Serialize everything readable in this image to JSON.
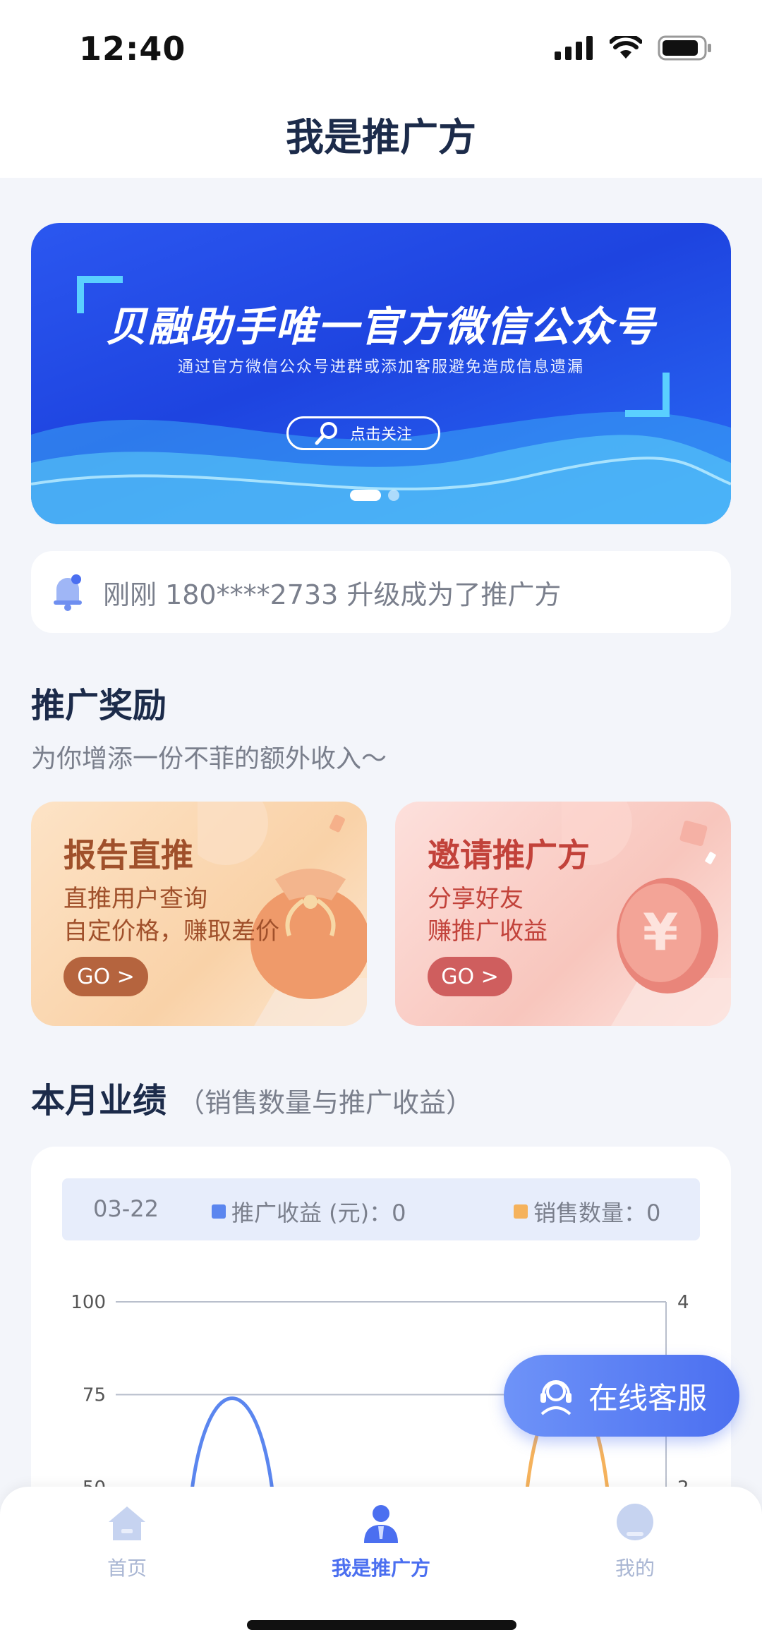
{
  "status_bar": {
    "time": "12:40"
  },
  "nav": {
    "title": "我是推广方"
  },
  "banner": {
    "title": "贝融助手唯一官方微信公众号",
    "subtitle": "通过官方微信公众号进群或添加客服避免造成信息遗漏",
    "button_label": "点击关注",
    "page_count": 2,
    "active_page": 1
  },
  "notice": {
    "text": "刚刚 180****2733 升级成为了推广方"
  },
  "rewards": {
    "title": "推广奖励",
    "subtitle": "为你增添一份不菲的额外收入～",
    "cards": [
      {
        "title": "报告直推",
        "line1": "直推用户查询",
        "line2": "自定价格，赚取差价",
        "go": "GO >"
      },
      {
        "title": "邀请推广方",
        "line1": "分享好友",
        "line2": "赚推广收益",
        "go": "GO >"
      }
    ]
  },
  "performance": {
    "title": "本月业绩",
    "note": "（销售数量与推广收益）",
    "legend": {
      "date": "03-22",
      "income_label": "推广收益 (元)：0",
      "sales_label": "销售数量：0"
    }
  },
  "chart_data": {
    "type": "line",
    "left_axis_ticks": [
      "100",
      "75",
      "50"
    ],
    "right_axis_ticks": [
      "4",
      "2"
    ],
    "ylim_left": [
      50,
      100
    ],
    "ylim_right": [
      2,
      4
    ],
    "series": [
      {
        "name": "推广收益 (元)",
        "color": "#5b86ef",
        "axis": "left",
        "peak": 79
      },
      {
        "name": "销售数量",
        "color": "#f5b25c",
        "axis": "right",
        "peak": 3.3
      }
    ],
    "grid": true
  },
  "colors": {
    "income": "#5b86ef",
    "sales": "#f5b25c",
    "accent": "#4b6ff0",
    "title": "#1c2b4a"
  },
  "fab": {
    "label": "在线客服"
  },
  "tabbar": {
    "items": [
      {
        "label": "首页",
        "icon": "home-icon",
        "active": false
      },
      {
        "label": "我是推广方",
        "icon": "promoter-icon",
        "active": true
      },
      {
        "label": "我的",
        "icon": "profile-icon",
        "active": false
      }
    ]
  }
}
